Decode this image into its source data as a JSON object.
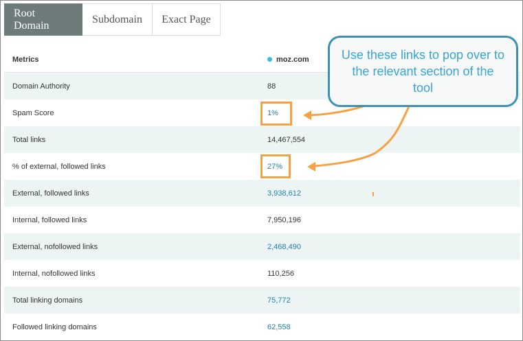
{
  "tabs": [
    {
      "label": "Root Domain",
      "active": true
    },
    {
      "label": "Subdomain",
      "active": false
    },
    {
      "label": "Exact Page",
      "active": false
    }
  ],
  "table": {
    "header": {
      "metric": "Metrics",
      "site": "moz.com",
      "site_dot_color": "#3bb7e8"
    },
    "rows": [
      {
        "metric": "Domain Authority",
        "value": "88",
        "link": false
      },
      {
        "metric": "Spam Score",
        "value": "1%",
        "link": true
      },
      {
        "metric": "Total links",
        "value": "14,467,554",
        "link": false
      },
      {
        "metric": "% of external, followed links",
        "value": "27%",
        "link": true
      },
      {
        "metric": "External, followed links",
        "value": "3,938,612",
        "link": true
      },
      {
        "metric": "Internal, followed links",
        "value": "7,950,196",
        "link": false
      },
      {
        "metric": "External, nofollowed links",
        "value": "2,468,490",
        "link": true
      },
      {
        "metric": "Internal, nofollowed links",
        "value": "110,256",
        "link": false
      },
      {
        "metric": "Total linking domains",
        "value": "75,772",
        "link": true
      },
      {
        "metric": "Followed linking domains",
        "value": "62,558",
        "link": true
      }
    ]
  },
  "callout": {
    "text": "Use these links to pop over to the relevant section of the tool"
  },
  "colors": {
    "highlight": "#f5a244",
    "callout_border": "#3d8fb6",
    "callout_text": "#3aa3d3",
    "link": "#1f7fae",
    "active_tab": "#6e7b7b"
  }
}
